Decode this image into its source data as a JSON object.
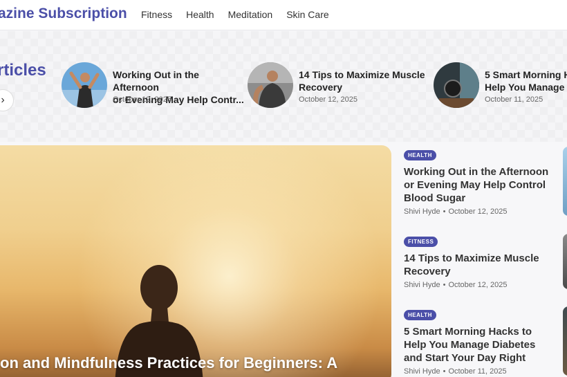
{
  "header": {
    "logo": "azine Subscription",
    "nav": [
      "Fitness",
      "Health",
      "Meditation",
      "Skin Care"
    ]
  },
  "trending": {
    "title": "rticles",
    "next_icon": "chevron-right-icon",
    "items": [
      {
        "title": "Working Out in the Afternoon\nor Evening May Help Contr...",
        "date": "October 12, 2025"
      },
      {
        "title": "14 Tips to Maximize Muscle\nRecovery",
        "date": "October 12, 2025"
      },
      {
        "title": "5 Smart Morning H\nHelp You Manage D",
        "date": "October 11, 2025"
      }
    ]
  },
  "hero": {
    "title": "on and Mindfulness Practices for Beginners: A"
  },
  "side_list": [
    {
      "category": "HEALTH",
      "title": "Working Out in the Afternoon\nor Evening May Help Control\nBlood Sugar",
      "author": "Shivi Hyde",
      "date": "October 12, 2025"
    },
    {
      "category": "FITNESS",
      "title": "14 Tips to Maximize Muscle\nRecovery",
      "author": "Shivi Hyde",
      "date": "October 12, 2025"
    },
    {
      "category": "HEALTH",
      "title": "5 Smart Morning Hacks to\nHelp You Manage Diabetes\nand Start Your Day Right",
      "author": "Shivi Hyde",
      "date": "October 11, 2025"
    }
  ],
  "colors": {
    "accent": "#4b4fa8"
  }
}
